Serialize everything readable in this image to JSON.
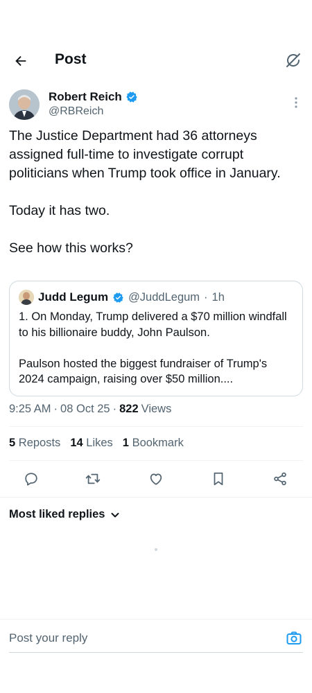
{
  "header": {
    "title": "Post"
  },
  "post": {
    "author_name": "Robert Reich",
    "author_handle": "@RBReich",
    "paragraphs": [
      "The Justice Department had 36 attorneys assigned full-time to investigate corrupt politicians when Trump took office in January.",
      "Today it has two.",
      "See how this works?"
    ],
    "time": "9:25 AM",
    "date": "08 Oct 25",
    "views_count": "822",
    "views_label": "Views",
    "separator": "·"
  },
  "quote": {
    "author_name": "Judd Legum",
    "author_handle": "@JuddLegum",
    "time": "1h",
    "separator": "·",
    "paragraphs": [
      "1. On Monday, Trump delivered a $70 million windfall to his billionaire buddy, John Paulson.",
      "Paulson hosted the biggest fundraiser of Trump's 2024 campaign, raising over $50 million...."
    ]
  },
  "stats": {
    "reposts_count": "5",
    "reposts_label": "Reposts",
    "likes_count": "14",
    "likes_label": "Likes",
    "bookmarks_count": "1",
    "bookmarks_label": "Bookmark"
  },
  "actions": [
    "reply-icon",
    "repost-icon",
    "like-icon",
    "bookmark-icon",
    "share-icon"
  ],
  "replies": {
    "sort_label": "Most liked replies"
  },
  "composer": {
    "placeholder": "Post your reply"
  },
  "colors": {
    "text": "#0f1419",
    "secondary": "#536471",
    "verified": "#1d9bf0",
    "border": "#cfd9de"
  }
}
